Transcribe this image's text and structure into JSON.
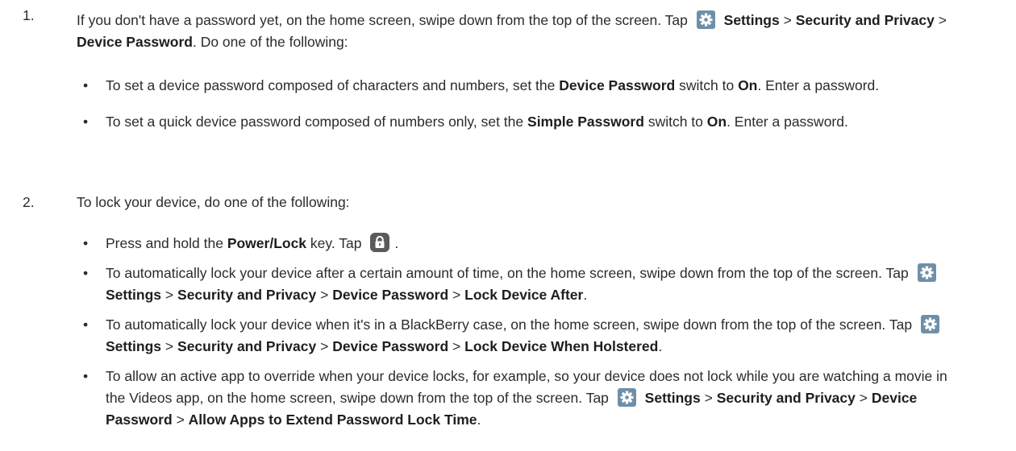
{
  "step1": {
    "number": "1.",
    "intro_a": "If you don't have a password yet, on the home screen, swipe down from the top of the screen. Tap",
    "settings": "Settings",
    "sep1": ">",
    "security": "Security and Privacy",
    "sep2": ">",
    "device_password": "Device Password",
    "intro_b": ". Do one of the following:",
    "bullets": [
      {
        "dot": "•",
        "a": "To set a device password composed of characters and numbers, set the",
        "bold1": "Device Password",
        "b": "switch to",
        "bold2": "On",
        "c": ". Enter a password."
      },
      {
        "dot": "•",
        "a": "To set a quick device password composed of numbers only, set the",
        "bold1": "Simple Password",
        "b": "switch to",
        "bold2": "On",
        "c": ". Enter a password."
      }
    ]
  },
  "step2": {
    "number": "2.",
    "intro": "To lock your device, do one of the following:",
    "bullets": [
      {
        "dot": "•",
        "a": "Press and hold the",
        "bold1": "Power/Lock",
        "b": "key. Tap",
        "end": "."
      },
      {
        "dot": "•",
        "a": "To automatically lock your device after a certain amount of time, on the home screen, swipe down from the top of the screen. Tap",
        "settings": "Settings",
        "sep1": ">",
        "security": "Security and Privacy",
        "sep2": ">",
        "device_password": "Device Password",
        "sep3": ">",
        "last": "Lock Device After",
        "end": "."
      },
      {
        "dot": "•",
        "a": "To automatically lock your device when it's in a BlackBerry case, on the home screen, swipe down from the top of the screen. Tap",
        "settings": "Settings",
        "sep1": ">",
        "security": "Security and Privacy",
        "sep2": ">",
        "device_password": "Device Password",
        "sep3": ">",
        "last": "Lock Device When Holstered",
        "end": "."
      },
      {
        "dot": "•",
        "a": "To allow an active app to override when your device locks, for example, so your device does not lock while you are watching a movie in the Videos app, on the home screen, swipe down from the top of the screen. Tap",
        "settings": "Settings",
        "sep1": ">",
        "security": "Security and Privacy",
        "sep2": ">",
        "device_password": "Device Password",
        "sep3": ">",
        "last": "Allow Apps to Extend Password Lock Time",
        "end": "."
      }
    ]
  },
  "icons": {
    "settings_icon": "gear-icon",
    "lock_icon": "lock-icon",
    "settings_icon_color": "#6f8fa8",
    "lock_icon_color": "#5a5a5a"
  }
}
